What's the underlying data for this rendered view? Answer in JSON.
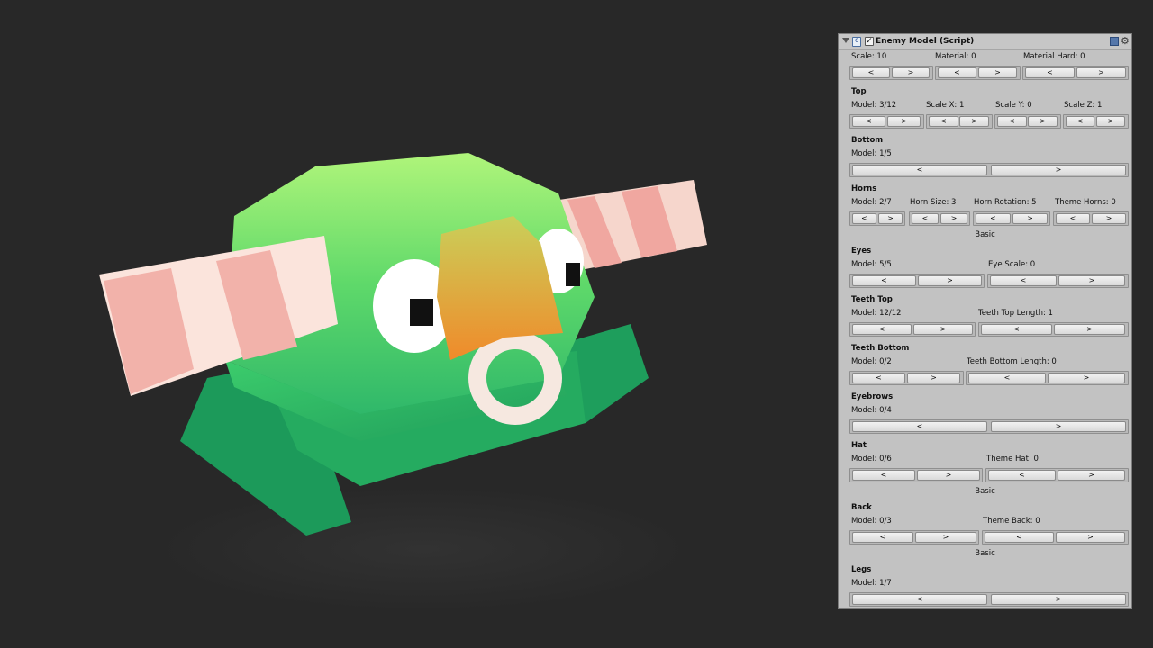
{
  "component": {
    "title": "Enemy Model (Script)",
    "checkbox": "✓"
  },
  "general": {
    "scale": "Scale: 10",
    "material": "Material: 0",
    "material_hard": "Material Hard: 0"
  },
  "top": {
    "title": "Top",
    "model": "Model: 3/12",
    "scale_x": "Scale X: 1",
    "scale_y": "Scale Y: 0",
    "scale_z": "Scale Z: 1"
  },
  "bottom": {
    "title": "Bottom",
    "model": "Model: 1/5"
  },
  "horns": {
    "title": "Horns",
    "model": "Model: 2/7",
    "size": "Horn Size: 3",
    "rotation": "Horn Rotation: 5",
    "theme": "Theme Horns: 0",
    "theme_name": "Basic"
  },
  "eyes": {
    "title": "Eyes",
    "model": "Model: 5/5",
    "scale": "Eye Scale: 0"
  },
  "teeth_top": {
    "title": "Teeth Top",
    "model": "Model: 12/12",
    "length": "Teeth Top Length: 1"
  },
  "teeth_bottom": {
    "title": "Teeth Bottom",
    "model": "Model: 0/2",
    "length": "Teeth Bottom Length: 0"
  },
  "eyebrows": {
    "title": "Eyebrows",
    "model": "Model: 0/4"
  },
  "hat": {
    "title": "Hat",
    "model": "Model: 0/6",
    "theme": "Theme Hat: 0",
    "theme_name": "Basic"
  },
  "back": {
    "title": "Back",
    "model": "Model: 0/3",
    "theme": "Theme Back: 0",
    "theme_name": "Basic"
  },
  "legs": {
    "title": "Legs",
    "model": "Model: 1/7"
  },
  "buttons": {
    "prev": "<",
    "next": ">"
  },
  "icons": {
    "fold": "triangle-down-icon",
    "script": "script-icon",
    "help": "book-icon",
    "settings": "gear-icon"
  },
  "colors": {
    "body_green": "#2fb86a",
    "body_light": "#8de86c",
    "horn_pink": "#f2b8b0",
    "beak_orange": "#e8902a",
    "viewport_bg": "#282828",
    "inspector_bg": "#c2c2c2"
  }
}
